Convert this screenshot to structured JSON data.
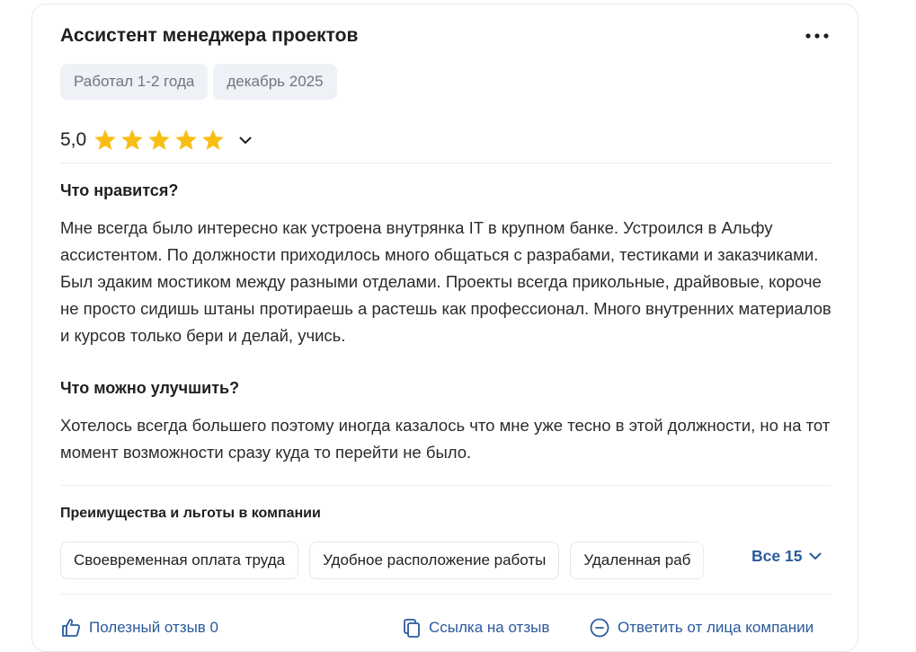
{
  "review": {
    "title": "Ассистент менеджера проектов",
    "experience": "Работал 1-2 года",
    "date": "декабрь 2025",
    "rating": "5,0",
    "stars": 5,
    "pros_title": "Что нравится?",
    "pros_text": "Мне всегда было интересно как устроена внутрянка IT в крупном банке. Устроился в Альфу ассистентом. По должности приходилось много общаться с разрабами, тестиками и заказчиками. Был эдаким мостиком между разными отделами. Проекты всегда прикольные, драйвовые, короче не просто сидишь штаны протираешь а растешь как профессионал. Много внутренних материалов и курсов только бери и делай, учись.",
    "cons_title": "Что можно улучшить?",
    "cons_text": "Хотелось всегда большего поэтому иногда казалось что мне уже тесно в этой должности, но на тот момент возможности сразу куда то перейти не было."
  },
  "benefits": {
    "title": "Преимущества и льготы в компании",
    "items": [
      "Своевременная оплата труда",
      "Удобное расположение работы",
      "Удаленная раб"
    ],
    "all_label": "Все 15"
  },
  "footer": {
    "useful_label": "Полезный отзыв 0",
    "link_label": "Ссылка на отзыв",
    "reply_label": "Ответить от лица компании"
  },
  "colors": {
    "star": "#f9be13",
    "accent": "#2b5a9c",
    "chip_bg": "#eef1f5"
  },
  "icons": [
    "more-dots-icon",
    "star-icon",
    "chevron-down-icon",
    "thumbs-up-icon",
    "link-icon",
    "chat-icon"
  ]
}
